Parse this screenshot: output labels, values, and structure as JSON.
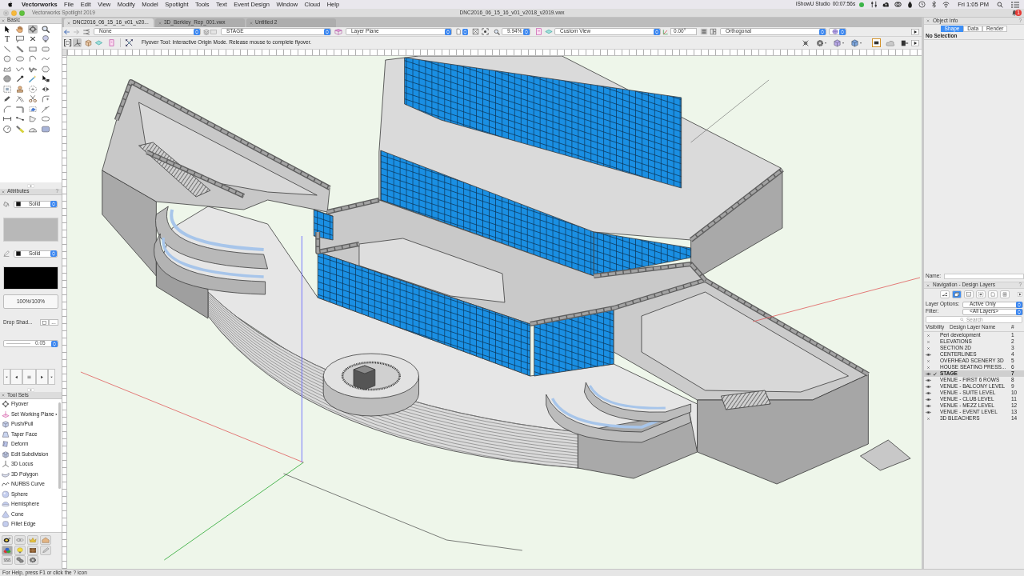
{
  "menu_bar": {
    "app": "Vectorworks",
    "menus": [
      "File",
      "Edit",
      "View",
      "Modify",
      "Model",
      "Spotlight",
      "Tools",
      "Text",
      "Event Design",
      "Window",
      "Cloud",
      "Help"
    ],
    "recorder": {
      "name": "iShowU Studio",
      "elapsed": "00:07:56s"
    },
    "clock": "Fri 1:05 PM"
  },
  "window": {
    "app_title": "Vectorworks Spotlight 2019",
    "title": "DNC2016_06_15_16_v01_v2018_v2019.vwx",
    "notifications": "1"
  },
  "document_tabs": [
    {
      "label": "DNC2016_06_15_16_v01_v20...",
      "selected": true
    },
    {
      "label": "3D_Berkley_Rep_001.vwx",
      "selected": false
    },
    {
      "label": "Untitled 2",
      "selected": false
    }
  ],
  "view_bar": {
    "class": "None",
    "layer": "STAGE",
    "plane": "Layer Plane",
    "zoom": "9.94%",
    "view": "Custom View",
    "rotation": "0.00°",
    "projection": "Orthogonal"
  },
  "mode_bar": {
    "modes": [
      {
        "kind": "bracket",
        "selected": false
      },
      {
        "kind": "axes",
        "selected": true
      },
      {
        "kind": "cube",
        "selected": false
      },
      {
        "kind": "plane",
        "selected": false
      },
      {
        "kind": "panel",
        "selected": false
      }
    ],
    "hint": "Flyover Tool: Interactive Origin Mode. Release mouse to complete flyover."
  },
  "basic_palette": {
    "title": "Basic",
    "tools": [
      {
        "kind": "arrow",
        "selected": false
      },
      {
        "kind": "hand",
        "selected": false
      },
      {
        "kind": "orbit",
        "selected": true
      },
      {
        "kind": "magnifier",
        "selected": false
      },
      {
        "kind": "text",
        "glyph": "T",
        "selected": false
      },
      {
        "kind": "callout",
        "selected": false
      },
      {
        "kind": "cross",
        "selected": false
      },
      {
        "kind": "bulb",
        "selected": false
      },
      {
        "kind": "line",
        "selected": false
      },
      {
        "kind": "thickline",
        "selected": false
      },
      {
        "kind": "rect",
        "selected": false
      },
      {
        "kind": "roundrect",
        "selected": false
      },
      {
        "kind": "circle",
        "selected": false
      },
      {
        "kind": "oval",
        "selected": false
      },
      {
        "kind": "arc",
        "selected": false
      },
      {
        "kind": "freehand",
        "selected": false
      },
      {
        "kind": "polygon",
        "selected": false
      },
      {
        "kind": "polyline",
        "selected": false
      },
      {
        "kind": "doublepoly",
        "selected": false
      },
      {
        "kind": "hexagon",
        "selected": false
      },
      {
        "kind": "ball",
        "selected": false
      },
      {
        "kind": "eyedropper",
        "selected": false
      },
      {
        "kind": "wand",
        "selected": false
      },
      {
        "kind": "pointer",
        "selected": false
      },
      {
        "kind": "frame",
        "selected": false
      },
      {
        "kind": "stamp",
        "selected": false
      },
      {
        "kind": "dottedcircle",
        "selected": false
      },
      {
        "kind": "mirror",
        "selected": false
      },
      {
        "kind": "pen",
        "selected": false
      },
      {
        "kind": "xlines",
        "selected": false
      },
      {
        "kind": "scissors",
        "selected": false
      },
      {
        "kind": "fillet",
        "selected": false
      },
      {
        "kind": "chamfer",
        "selected": false
      },
      {
        "kind": "joint",
        "selected": false
      },
      {
        "kind": "clip",
        "selected": false
      },
      {
        "kind": "connect",
        "selected": false
      },
      {
        "kind": "dimension",
        "selected": false
      },
      {
        "kind": "measure",
        "selected": false
      },
      {
        "kind": "pentagon",
        "selected": false
      },
      {
        "kind": "roundframe",
        "selected": false
      },
      {
        "kind": "clock",
        "selected": false
      },
      {
        "kind": "flashlight",
        "selected": false
      },
      {
        "kind": "protractor",
        "selected": false
      },
      {
        "kind": "box",
        "selected": false
      }
    ]
  },
  "attributes": {
    "title": "Attributes",
    "help": "?",
    "fill_style": "Solid",
    "pen_style": "Solid",
    "opacity": "100%/100%",
    "drop_shadow": "Drop Shad...",
    "drop_shadow_checked": false,
    "drop_shadow_edit": "...",
    "line_weight": "0.05"
  },
  "tool_sets": {
    "title": "Tool Sets",
    "tools": [
      {
        "label": "Flyover",
        "kind": "orbit",
        "submenu": false
      },
      {
        "label": "Set Working Plane",
        "kind": "tilt",
        "submenu": true
      },
      {
        "label": "Push/Pull",
        "kind": "cube",
        "submenu": false
      },
      {
        "label": "Taper Face",
        "kind": "taper",
        "submenu": false
      },
      {
        "label": "Deform",
        "kind": "twist",
        "submenu": false
      },
      {
        "label": "Edit Subdivision",
        "kind": "gridcube",
        "submenu": false
      },
      {
        "label": "3D Locus",
        "kind": "tripod",
        "submenu": false
      },
      {
        "label": "3D Polygon",
        "kind": "surface",
        "submenu": false
      },
      {
        "label": "NURBS Curve",
        "kind": "curve",
        "submenu": false
      },
      {
        "label": "Sphere",
        "kind": "sphere",
        "submenu": false
      },
      {
        "label": "Hemisphere",
        "kind": "hemisphere",
        "submenu": false
      },
      {
        "label": "Cone",
        "kind": "cone",
        "submenu": false
      },
      {
        "label": "Fillet Edge",
        "kind": "roundcube",
        "submenu": false
      }
    ],
    "sets": [
      {
        "kind": "fixture",
        "selected": false
      },
      {
        "kind": "chain",
        "selected": false
      },
      {
        "kind": "crown",
        "selected": false
      },
      {
        "kind": "house",
        "selected": false
      },
      {
        "kind": "spheres",
        "selected": true
      },
      {
        "kind": "bulb",
        "selected": false
      },
      {
        "kind": "crate",
        "selected": false
      },
      {
        "kind": "pencil",
        "selected": false
      },
      {
        "kind": "truss",
        "selected": false
      },
      {
        "kind": "gears",
        "selected": false
      },
      {
        "kind": "gear",
        "selected": false
      }
    ]
  },
  "object_info": {
    "title": "Object Info",
    "help": "?",
    "tabs": [
      {
        "label": "Shape",
        "selected": true
      },
      {
        "label": "Data",
        "selected": false
      },
      {
        "label": "Render",
        "selected": false
      }
    ],
    "selection": "No Selection",
    "name_label": "Name:"
  },
  "navigation": {
    "title": "Navigation - Design Layers",
    "help": "?",
    "views": [
      {
        "kind": "network",
        "selected": false
      },
      {
        "kind": "stack",
        "selected": true
      },
      {
        "kind": "sheet",
        "selected": false
      },
      {
        "kind": "grid",
        "selected": false
      },
      {
        "kind": "page",
        "selected": false
      },
      {
        "kind": "find",
        "selected": false
      }
    ],
    "layer_options_label": "Layer Options:",
    "layer_options": "Active Only",
    "filter_label": "Filter:",
    "filter": "<All Layers>",
    "search_placeholder": "Search",
    "columns": [
      "Visibility",
      "Design Layer Name",
      "#"
    ],
    "layers": [
      {
        "name": "Peri development",
        "number": "1",
        "visible": false,
        "active": false,
        "selected": false
      },
      {
        "name": "ELEVATIONS",
        "number": "2",
        "visible": false,
        "active": false,
        "selected": false
      },
      {
        "name": "SECTION 2D",
        "number": "3",
        "visible": false,
        "active": false,
        "selected": false
      },
      {
        "name": "CENTERLINES",
        "number": "4",
        "visible": true,
        "active": false,
        "selected": false
      },
      {
        "name": "OVERHEAD SCENERY 3D",
        "number": "5",
        "visible": false,
        "active": false,
        "selected": false
      },
      {
        "name": "HOUSE SEATING PRESS...",
        "number": "6",
        "visible": false,
        "active": false,
        "selected": false
      },
      {
        "name": "STAGE",
        "number": "7",
        "visible": true,
        "active": true,
        "selected": true
      },
      {
        "name": "VENUE - FIRST 6 ROWS",
        "number": "8",
        "visible": true,
        "active": false,
        "selected": false
      },
      {
        "name": "VENUE - BALCONY LEVEL",
        "number": "9",
        "visible": true,
        "active": false,
        "selected": false
      },
      {
        "name": "VENUE - SUITE LEVEL",
        "number": "10",
        "visible": true,
        "active": false,
        "selected": false
      },
      {
        "name": "VENUE - CLUB LEVEL",
        "number": "11",
        "visible": true,
        "active": false,
        "selected": false
      },
      {
        "name": "VENUE - MEZZ LEVEL",
        "number": "12",
        "visible": true,
        "active": false,
        "selected": false
      },
      {
        "name": "VENUE - EVENT LEVEL",
        "number": "13",
        "visible": true,
        "active": false,
        "selected": false
      },
      {
        "name": "3D BLEACHERS",
        "number": "14",
        "visible": false,
        "active": false,
        "selected": false
      }
    ]
  },
  "status_bar": "For Help, press F1 or click the ? icon"
}
